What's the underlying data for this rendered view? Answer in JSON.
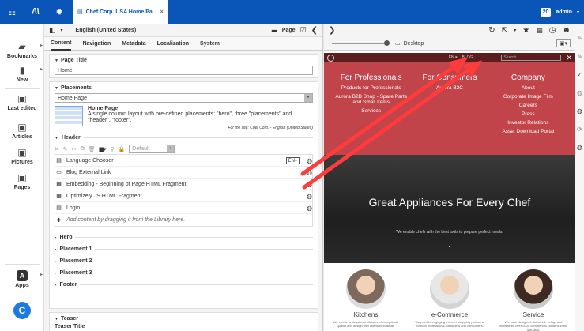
{
  "topbar": {
    "tab_title": "Chef Corp. USA Home Pa...",
    "count": "20",
    "user": "admin"
  },
  "leftnav": {
    "items": [
      {
        "label": "Bookmarks",
        "icon": "bookmarks-icon"
      },
      {
        "label": "New",
        "icon": "new-document-icon"
      },
      {
        "label": "Last edited",
        "icon": "last-edited-icon"
      },
      {
        "label": "Articles",
        "icon": "articles-icon"
      },
      {
        "label": "Pictures",
        "icon": "pictures-icon"
      },
      {
        "label": "Pages",
        "icon": "pages-icon"
      },
      {
        "label": "Apps",
        "icon": "apps-icon"
      }
    ]
  },
  "editor": {
    "locale": "English (United States)",
    "type": "Page",
    "tabs": [
      "Content",
      "Navigation",
      "Metadata",
      "Localization",
      "System"
    ],
    "page_title_label": "Page Title",
    "page_title_value": "Home",
    "placements_label": "Placements",
    "layout_select": "Home Page",
    "layout_name": "Home Page",
    "layout_desc": "A single column layout with pre-defined placements: \"hero\", three \"placements\" and \"header\", \"footer\".",
    "layout_site": "For the site: Chef Corp. - English (United States)",
    "header_label": "Header",
    "view_select": "Default",
    "lang_badge": "EN",
    "rows": [
      {
        "label": "Language Chooser",
        "icon": "page-icon"
      },
      {
        "label": "Blog External Link",
        "icon": "link-icon"
      },
      {
        "label": "Embedding - Beginning of Page HTML Fragment",
        "icon": "html-icon"
      },
      {
        "label": "Optimizely JS HTML Fragment",
        "icon": "html-icon"
      },
      {
        "label": "Login",
        "icon": "page-icon"
      }
    ],
    "add_hint": "Add content by dragging it from the Library here.",
    "sections": [
      "Hero",
      "Placement 1",
      "Placement 2",
      "Placement 3",
      "Footer"
    ],
    "teaser_label": "Teaser",
    "teaser_title": "Teaser Title"
  },
  "preview": {
    "device": "Desktop",
    "site_header": {
      "lang": "EN",
      "blog": "BLOG",
      "search": "Search"
    },
    "columns": [
      {
        "heading": "For Professionals",
        "items": [
          "Products for Professionals",
          "Aurora B2B Shop - Spare Parts and Small Items",
          "Services"
        ]
      },
      {
        "heading": "For Consumers",
        "items": [
          "Aurora B2C"
        ]
      },
      {
        "heading": "Company",
        "items": [
          "About",
          "Corporate Image Film",
          "Careers",
          "Press",
          "Investor Relations",
          "Asset Download Portal"
        ]
      }
    ],
    "hero_title": "Great Appliances For Every Chef",
    "hero_sub": "We enable chefs with the best tools to prepare perfect meals.",
    "features": [
      {
        "title": "Kitchens",
        "desc": "We create professional kitchens of exceptional quality and design with attention to detail."
      },
      {
        "title": "e-Commerce",
        "desc": "We provide engaging Internet shopping platforms for both professional customers and consumers."
      },
      {
        "title": "Service",
        "desc": "We have designed, delivered, set-up and maintained over 2000 commercial kitchens in the last year."
      }
    ]
  },
  "colors": {
    "brand_blue": "#0a55b8",
    "site_red": "#c1444a",
    "arrow_red": "#ff3b3b"
  }
}
